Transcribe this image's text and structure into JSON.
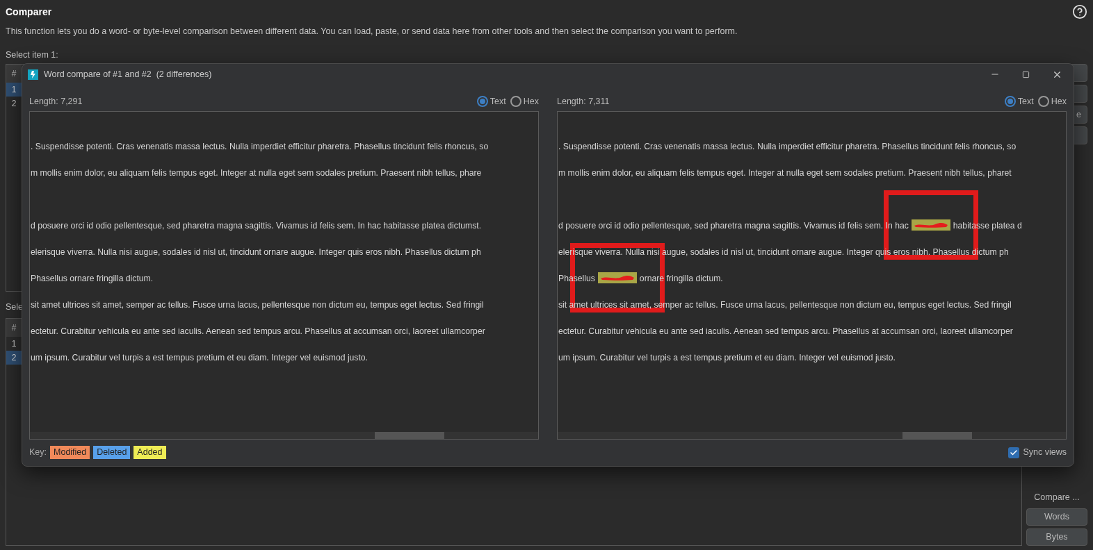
{
  "page": {
    "title": "Comparer",
    "description": "This function lets you do a word- or byte-level comparison between different data. You can load, paste, or send data here from other tools and then select the comparison you want to perform."
  },
  "section_1": {
    "label": "Select item 1:",
    "header": "#",
    "rows": [
      {
        "text": "1",
        "selected": true
      },
      {
        "text": "2",
        "selected": false
      }
    ],
    "button_fragment": "e"
  },
  "section_2": {
    "label": "Sele",
    "header": "#",
    "rows": [
      {
        "text": "1",
        "selected": false
      },
      {
        "text": "2",
        "selected": true
      }
    ],
    "compare_label": "Compare ...",
    "buttons": [
      "Words",
      "Bytes"
    ]
  },
  "dialog": {
    "title": "Word compare of #1 and #2  (2 differences)",
    "panes": [
      {
        "length": "Length: 7,291",
        "radios": [
          {
            "label": "Text",
            "selected": true
          },
          {
            "label": "Hex",
            "selected": false
          }
        ],
        "lines": [
          {
            "kind": "text",
            "segments": [
              {
                "kind": "text",
                "text": ". Suspendisse potenti. Cras venenatis massa lectus. Nulla imperdiet efficitur pharetra. Phasellus tincidunt felis rhoncus, so"
              }
            ]
          },
          {
            "kind": "text",
            "segments": [
              {
                "kind": "text",
                "text": "m mollis enim dolor, eu aliquam felis tempus eget. Integer at nulla eget sem sodales pretium. Praesent nibh tellus, phare"
              }
            ]
          },
          {
            "kind": "blank"
          },
          {
            "kind": "text",
            "segments": [
              {
                "kind": "text",
                "text": "d posuere orci id odio pellentesque, sed pharetra magna sagittis. Vivamus id felis sem. In hac habitasse platea dictumst."
              }
            ]
          },
          {
            "kind": "text",
            "segments": [
              {
                "kind": "text",
                "text": "elerisque viverra. Nulla nisi augue, sodales id nisl ut, tincidunt ornare augue. Integer quis eros nibh. Phasellus dictum ph"
              }
            ]
          },
          {
            "kind": "text",
            "segments": [
              {
                "kind": "text",
                "text": "Phasellus ornare fringilla dictum."
              }
            ]
          },
          {
            "kind": "text",
            "segments": [
              {
                "kind": "text",
                "text": "sit amet ultrices sit amet, semper ac tellus. Fusce urna lacus, pellentesque non dictum eu, tempus eget lectus. Sed fringil"
              }
            ]
          },
          {
            "kind": "text",
            "segments": [
              {
                "kind": "text",
                "text": "ectetur. Curabitur vehicula eu ante sed iaculis. Aenean sed tempus arcu. Phasellus at accumsan orci, laoreet ullamcorper"
              }
            ]
          },
          {
            "kind": "text",
            "segments": [
              {
                "kind": "text",
                "text": "um ipsum. Curabitur vel turpis a est tempus pretium et eu diam. Integer vel euismod justo."
              }
            ]
          }
        ]
      },
      {
        "length": "Length: 7,311",
        "radios": [
          {
            "label": "Text",
            "selected": true
          },
          {
            "label": "Hex",
            "selected": false
          }
        ],
        "lines": [
          {
            "kind": "text",
            "segments": [
              {
                "kind": "text",
                "text": ". Suspendisse potenti. Cras venenatis massa lectus. Nulla imperdiet efficitur pharetra. Phasellus tincidunt felis rhoncus, so"
              }
            ]
          },
          {
            "kind": "text",
            "segments": [
              {
                "kind": "text",
                "text": "m mollis enim dolor, eu aliquam felis tempus eget. Integer at nulla eget sem sodales pretium. Praesent nibh tellus, pharet"
              }
            ]
          },
          {
            "kind": "blank"
          },
          {
            "kind": "text",
            "segments": [
              {
                "kind": "text",
                "text": "d posuere orci id odio pellentesque, sed pharetra magna sagittis. Vivamus id felis sem. In hac"
              },
              {
                "kind": "added",
                "annotated": true
              },
              {
                "kind": "text",
                "text": "habitasse platea d"
              }
            ]
          },
          {
            "kind": "text",
            "segments": [
              {
                "kind": "text",
                "text": "elerisque viverra. Nulla nisi augue, sodales id nisl ut, tincidunt ornare augue. Integer quis eros nibh. Phasellus dictum ph"
              }
            ]
          },
          {
            "kind": "text",
            "segments": [
              {
                "kind": "text",
                "text": "Phasellus"
              },
              {
                "kind": "added",
                "annotated": true
              },
              {
                "kind": "text",
                "text": "ornare fringilla dictum."
              }
            ]
          },
          {
            "kind": "text",
            "segments": [
              {
                "kind": "text",
                "text": "sit amet ultrices sit amet, semper ac tellus. Fusce urna lacus, pellentesque non dictum eu, tempus eget lectus. Sed fringil"
              }
            ]
          },
          {
            "kind": "text",
            "segments": [
              {
                "kind": "text",
                "text": "ectetur. Curabitur vehicula eu ante sed iaculis. Aenean sed tempus arcu. Phasellus at accumsan orci, laoreet ullamcorper"
              }
            ]
          },
          {
            "kind": "text",
            "segments": [
              {
                "kind": "text",
                "text": "um ipsum. Curabitur vel turpis a est tempus pretium et eu diam. Integer vel euismod justo."
              }
            ]
          }
        ]
      }
    ],
    "key": {
      "label": "Key:",
      "items": [
        {
          "label": "Modified",
          "color": "#f0895a"
        },
        {
          "label": "Deleted",
          "color": "#58a0ea"
        },
        {
          "label": "Added",
          "color": "#eeec55"
        }
      ]
    },
    "sync": {
      "label": "Sync views",
      "checked": true
    }
  }
}
